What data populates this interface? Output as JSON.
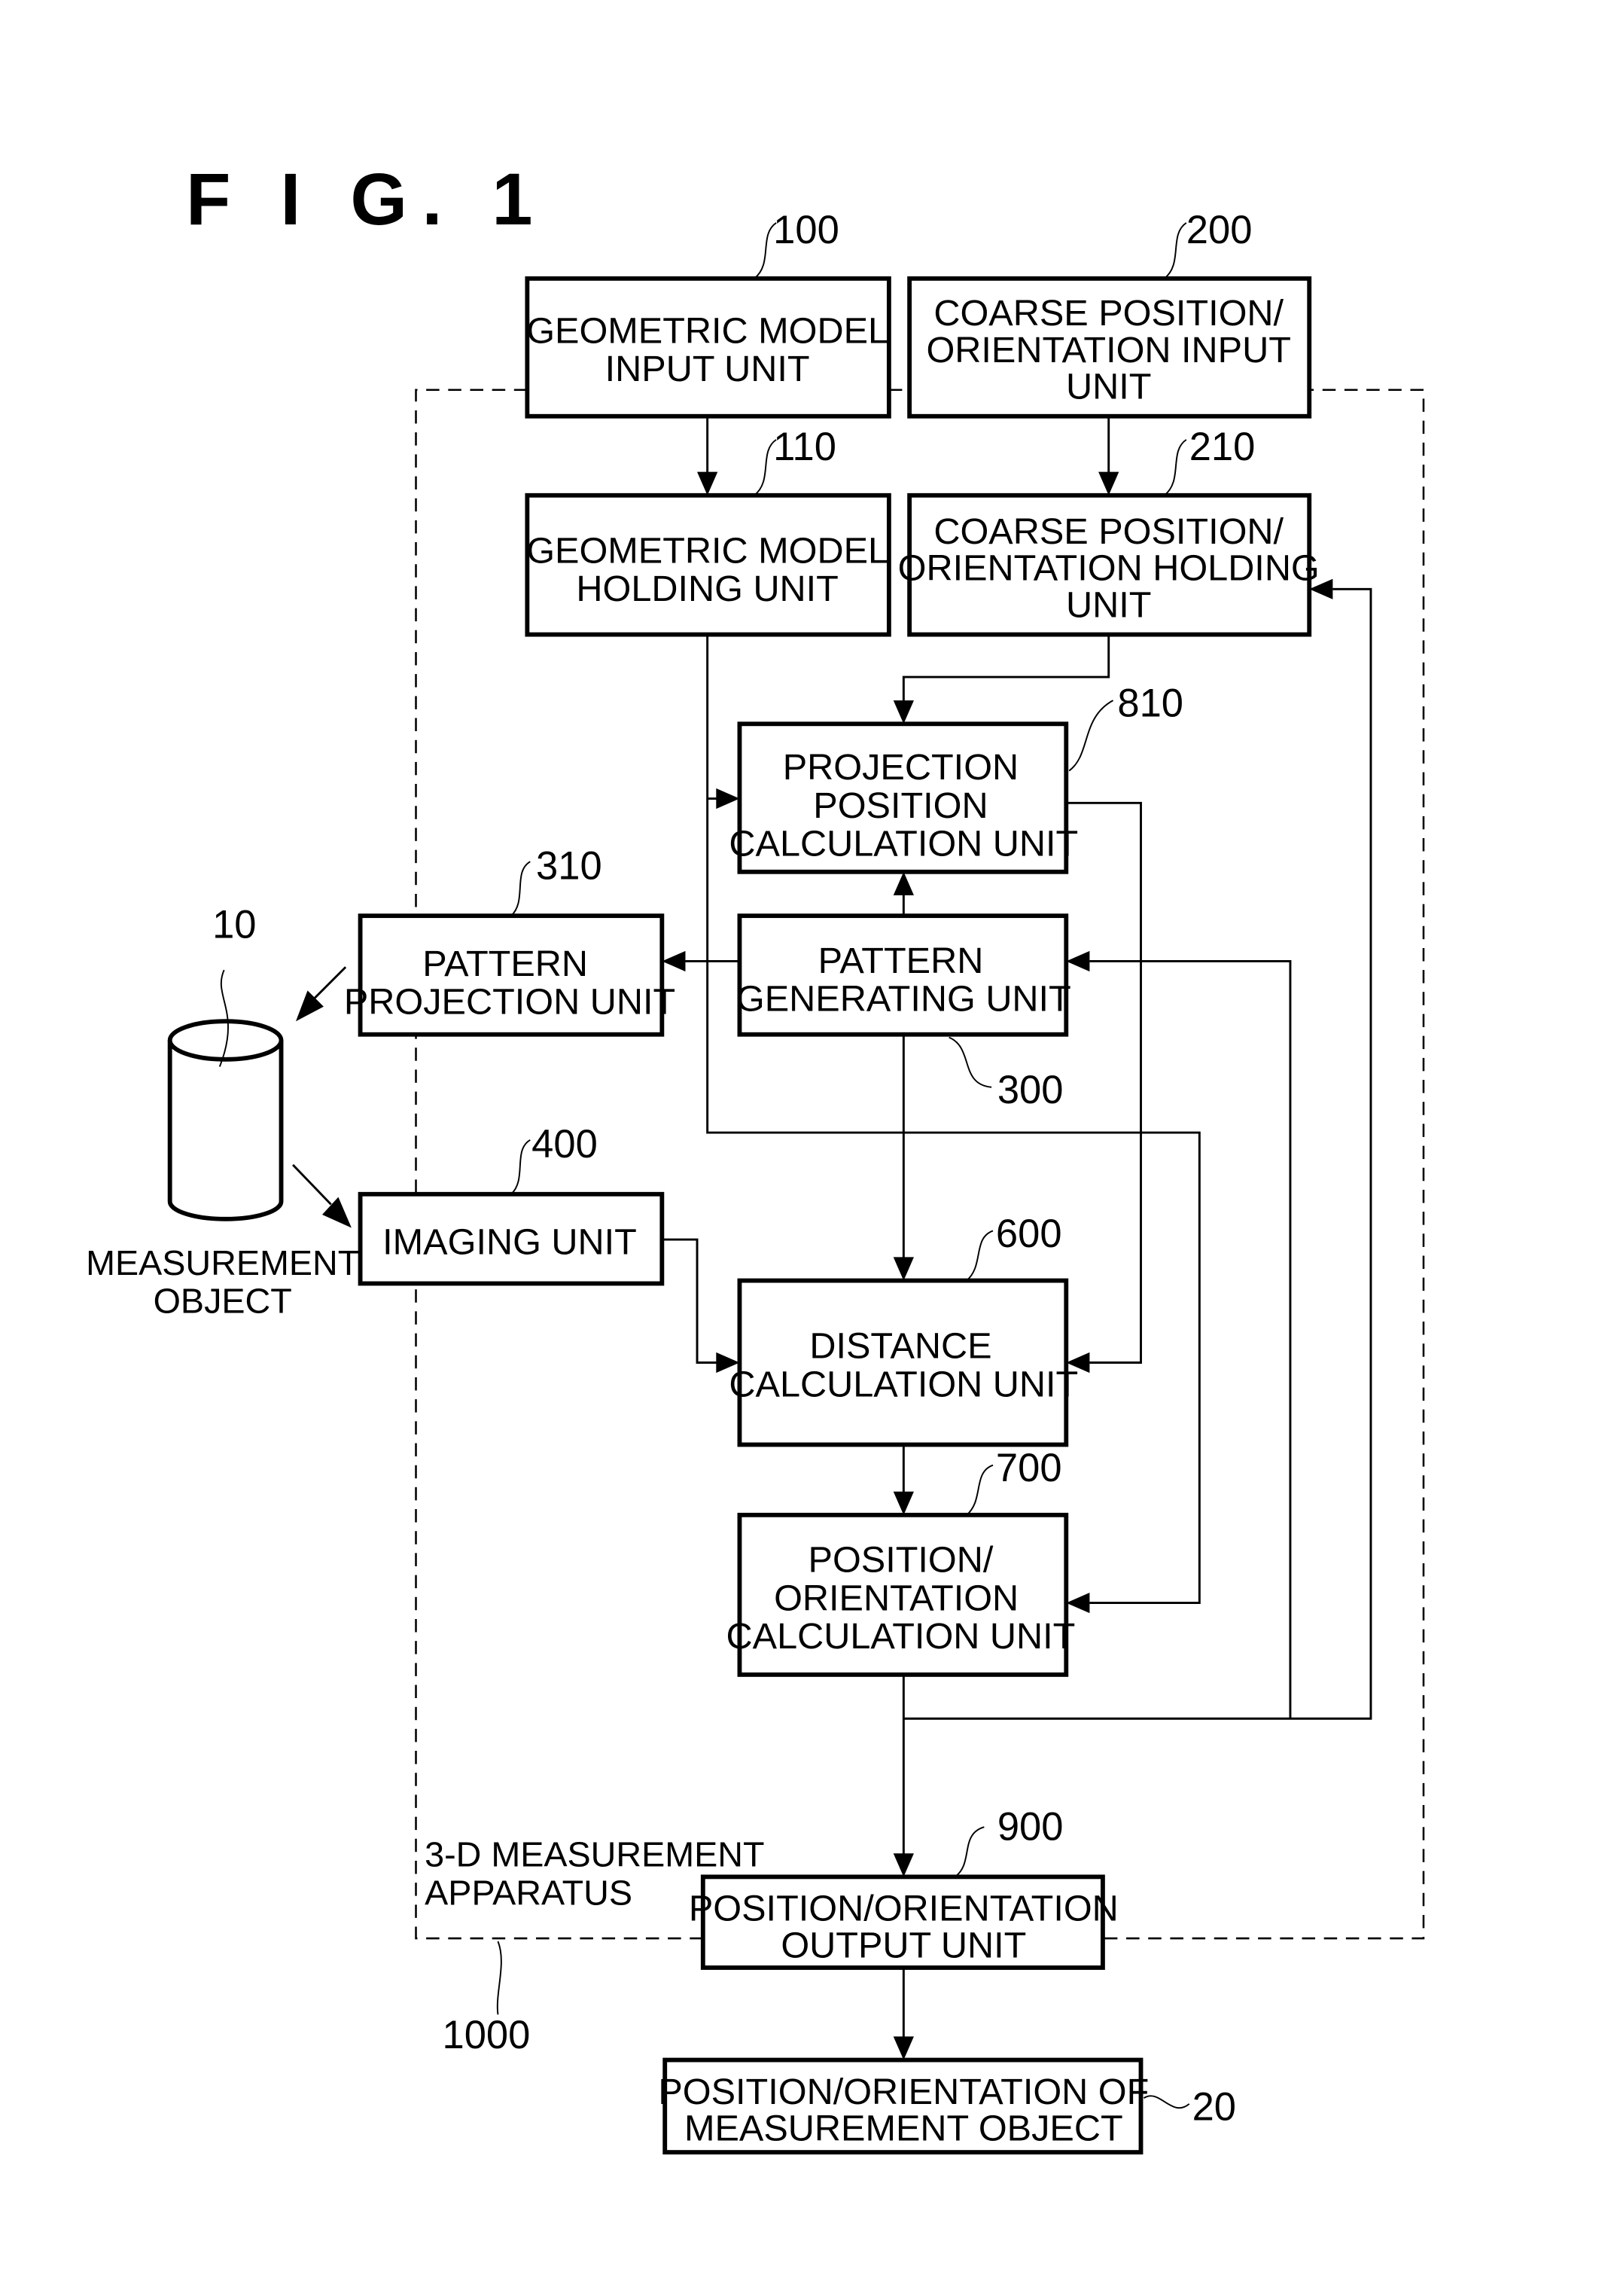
{
  "figure": {
    "title": "F I G.  1",
    "apparatus": {
      "ref": "1000",
      "label": [
        "3-D MEASUREMENT",
        "APPARATUS"
      ]
    },
    "measurement_object": {
      "ref": "10",
      "label": [
        "MEASUREMENT",
        "OBJECT"
      ]
    },
    "output": {
      "ref": "20",
      "label": [
        "POSITION/ORIENTATION OF",
        "MEASUREMENT OBJECT"
      ]
    },
    "units": {
      "u100": {
        "ref": "100",
        "label": [
          "GEOMETRIC MODEL",
          "INPUT UNIT"
        ]
      },
      "u200": {
        "ref": "200",
        "label": [
          "COARSE POSITION/",
          "ORIENTATION INPUT",
          "UNIT"
        ]
      },
      "u110": {
        "ref": "110",
        "label": [
          "GEOMETRIC MODEL",
          "HOLDING UNIT"
        ]
      },
      "u210": {
        "ref": "210",
        "label": [
          "COARSE POSITION/",
          "ORIENTATION HOLDING",
          "UNIT"
        ]
      },
      "u810": {
        "ref": "810",
        "label": [
          "PROJECTION",
          "POSITION",
          "CALCULATION UNIT"
        ]
      },
      "u310": {
        "ref": "310",
        "label": [
          "PATTERN",
          "PROJECTION UNIT"
        ]
      },
      "u300": {
        "ref": "300",
        "label": [
          "PATTERN",
          "GENERATING UNIT"
        ]
      },
      "u400": {
        "ref": "400",
        "label": [
          "IMAGING UNIT"
        ]
      },
      "u600": {
        "ref": "600",
        "label": [
          "DISTANCE",
          "CALCULATION UNIT"
        ]
      },
      "u700": {
        "ref": "700",
        "label": [
          "POSITION/",
          "ORIENTATION",
          "CALCULATION UNIT"
        ]
      },
      "u900": {
        "ref": "900",
        "label": [
          "POSITION/ORIENTATION",
          "OUTPUT UNIT"
        ]
      }
    }
  }
}
